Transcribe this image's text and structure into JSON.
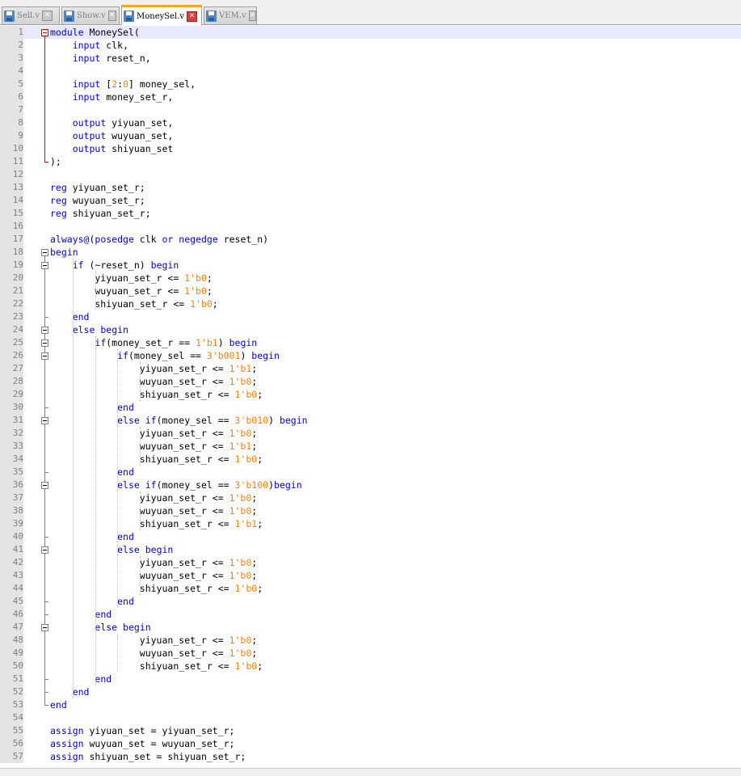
{
  "tabs": [
    {
      "label": "Sell.v",
      "active": false
    },
    {
      "label": "Show.v",
      "active": false
    },
    {
      "label": "MoneySel.v",
      "active": true
    },
    {
      "label": "VEM.v",
      "active": false
    }
  ],
  "colors": {
    "keyword": "#0000e0",
    "number": "#ff8000",
    "current_line": "#e8e8ff",
    "active_tab_accent": "#f5a623"
  },
  "current_line": 1,
  "code_lines": [
    [
      {
        "t": "module",
        "k": "kw"
      },
      {
        "t": " MoneySel("
      }
    ],
    [
      {
        "t": "    "
      },
      {
        "t": "input",
        "k": "kw"
      },
      {
        "t": " clk,"
      }
    ],
    [
      {
        "t": "    "
      },
      {
        "t": "input",
        "k": "kw"
      },
      {
        "t": " reset_n,"
      }
    ],
    [],
    [
      {
        "t": "    "
      },
      {
        "t": "input",
        "k": "kw"
      },
      {
        "t": " ["
      },
      {
        "t": "2",
        "k": "num"
      },
      {
        "t": ":"
      },
      {
        "t": "0",
        "k": "num"
      },
      {
        "t": "] money_sel,"
      }
    ],
    [
      {
        "t": "    "
      },
      {
        "t": "input",
        "k": "kw"
      },
      {
        "t": " money_set_r,"
      }
    ],
    [],
    [
      {
        "t": "    "
      },
      {
        "t": "output",
        "k": "kw"
      },
      {
        "t": " yiyuan_set,"
      }
    ],
    [
      {
        "t": "    "
      },
      {
        "t": "output",
        "k": "kw"
      },
      {
        "t": " wuyuan_set,"
      }
    ],
    [
      {
        "t": "    "
      },
      {
        "t": "output",
        "k": "kw"
      },
      {
        "t": " shiyuan_set"
      }
    ],
    [
      {
        "t": ");"
      }
    ],
    [],
    [
      {
        "t": "reg",
        "k": "kw"
      },
      {
        "t": " yiyuan_set_r;"
      }
    ],
    [
      {
        "t": "reg",
        "k": "kw"
      },
      {
        "t": " wuyuan_set_r;"
      }
    ],
    [
      {
        "t": "reg",
        "k": "kw"
      },
      {
        "t": " shiyuan_set_r;"
      }
    ],
    [],
    [
      {
        "t": "always@",
        "k": "kw"
      },
      {
        "t": "("
      },
      {
        "t": "posedge",
        "k": "kw"
      },
      {
        "t": " clk "
      },
      {
        "t": "or",
        "k": "kw"
      },
      {
        "t": " "
      },
      {
        "t": "negedge",
        "k": "kw"
      },
      {
        "t": " reset_n)"
      }
    ],
    [
      {
        "t": "begin",
        "k": "kw"
      }
    ],
    [
      {
        "t": "    "
      },
      {
        "t": "if",
        "k": "kw"
      },
      {
        "t": " (~reset_n) "
      },
      {
        "t": "begin",
        "k": "kw"
      }
    ],
    [
      {
        "t": "        yiyuan_set_r <= "
      },
      {
        "t": "1'b0",
        "k": "num"
      },
      {
        "t": ";"
      }
    ],
    [
      {
        "t": "        wuyuan_set_r <= "
      },
      {
        "t": "1'b0",
        "k": "num"
      },
      {
        "t": ";"
      }
    ],
    [
      {
        "t": "        shiyuan_set_r <= "
      },
      {
        "t": "1'b0",
        "k": "num"
      },
      {
        "t": ";"
      }
    ],
    [
      {
        "t": "    "
      },
      {
        "t": "end",
        "k": "kw"
      }
    ],
    [
      {
        "t": "    "
      },
      {
        "t": "else",
        "k": "kw"
      },
      {
        "t": " "
      },
      {
        "t": "begin",
        "k": "kw"
      }
    ],
    [
      {
        "t": "        "
      },
      {
        "t": "if",
        "k": "kw"
      },
      {
        "t": "(money_set_r == "
      },
      {
        "t": "1'b1",
        "k": "num"
      },
      {
        "t": ") "
      },
      {
        "t": "begin",
        "k": "kw"
      }
    ],
    [
      {
        "t": "            "
      },
      {
        "t": "if",
        "k": "kw"
      },
      {
        "t": "(money_sel == "
      },
      {
        "t": "3'b001",
        "k": "num"
      },
      {
        "t": ") "
      },
      {
        "t": "begin",
        "k": "kw"
      }
    ],
    [
      {
        "t": "                yiyuan_set_r <= "
      },
      {
        "t": "1'b1",
        "k": "num"
      },
      {
        "t": ";"
      }
    ],
    [
      {
        "t": "                wuyuan_set_r <= "
      },
      {
        "t": "1'b0",
        "k": "num"
      },
      {
        "t": ";"
      }
    ],
    [
      {
        "t": "                shiyuan_set_r <= "
      },
      {
        "t": "1'b0",
        "k": "num"
      },
      {
        "t": ";"
      }
    ],
    [
      {
        "t": "            "
      },
      {
        "t": "end",
        "k": "kw"
      }
    ],
    [
      {
        "t": "            "
      },
      {
        "t": "else",
        "k": "kw"
      },
      {
        "t": " "
      },
      {
        "t": "if",
        "k": "kw"
      },
      {
        "t": "(money_sel == "
      },
      {
        "t": "3'b010",
        "k": "num"
      },
      {
        "t": ") "
      },
      {
        "t": "begin",
        "k": "kw"
      }
    ],
    [
      {
        "t": "                yiyuan_set_r <= "
      },
      {
        "t": "1'b0",
        "k": "num"
      },
      {
        "t": ";"
      }
    ],
    [
      {
        "t": "                wuyuan_set_r <= "
      },
      {
        "t": "1'b1",
        "k": "num"
      },
      {
        "t": ";"
      }
    ],
    [
      {
        "t": "                shiyuan_set_r <= "
      },
      {
        "t": "1'b0",
        "k": "num"
      },
      {
        "t": ";"
      }
    ],
    [
      {
        "t": "            "
      },
      {
        "t": "end",
        "k": "kw"
      }
    ],
    [
      {
        "t": "            "
      },
      {
        "t": "else",
        "k": "kw"
      },
      {
        "t": " "
      },
      {
        "t": "if",
        "k": "kw"
      },
      {
        "t": "(money_sel == "
      },
      {
        "t": "3'b100",
        "k": "num"
      },
      {
        "t": ")"
      },
      {
        "t": "begin",
        "k": "kw"
      }
    ],
    [
      {
        "t": "                yiyuan_set_r <= "
      },
      {
        "t": "1'b0",
        "k": "num"
      },
      {
        "t": ";"
      }
    ],
    [
      {
        "t": "                wuyuan_set_r <= "
      },
      {
        "t": "1'b0",
        "k": "num"
      },
      {
        "t": ";"
      }
    ],
    [
      {
        "t": "                shiyuan_set_r <= "
      },
      {
        "t": "1'b1",
        "k": "num"
      },
      {
        "t": ";"
      }
    ],
    [
      {
        "t": "            "
      },
      {
        "t": "end",
        "k": "kw"
      }
    ],
    [
      {
        "t": "            "
      },
      {
        "t": "else",
        "k": "kw"
      },
      {
        "t": " "
      },
      {
        "t": "begin",
        "k": "kw"
      }
    ],
    [
      {
        "t": "                yiyuan_set_r <= "
      },
      {
        "t": "1'b0",
        "k": "num"
      },
      {
        "t": ";"
      }
    ],
    [
      {
        "t": "                wuyuan_set_r <= "
      },
      {
        "t": "1'b0",
        "k": "num"
      },
      {
        "t": ";"
      }
    ],
    [
      {
        "t": "                shiyuan_set_r <= "
      },
      {
        "t": "1'b0",
        "k": "num"
      },
      {
        "t": ";"
      }
    ],
    [
      {
        "t": "            "
      },
      {
        "t": "end",
        "k": "kw"
      }
    ],
    [
      {
        "t": "        "
      },
      {
        "t": "end",
        "k": "kw"
      }
    ],
    [
      {
        "t": "        "
      },
      {
        "t": "else",
        "k": "kw"
      },
      {
        "t": " "
      },
      {
        "t": "begin",
        "k": "kw"
      }
    ],
    [
      {
        "t": "                yiyuan_set_r <= "
      },
      {
        "t": "1'b0",
        "k": "num"
      },
      {
        "t": ";"
      }
    ],
    [
      {
        "t": "                wuyuan_set_r <= "
      },
      {
        "t": "1'b0",
        "k": "num"
      },
      {
        "t": ";"
      }
    ],
    [
      {
        "t": "                shiyuan_set_r <= "
      },
      {
        "t": "1'b0",
        "k": "num"
      },
      {
        "t": ";"
      }
    ],
    [
      {
        "t": "        "
      },
      {
        "t": "end",
        "k": "kw"
      }
    ],
    [
      {
        "t": "    "
      },
      {
        "t": "end",
        "k": "kw"
      }
    ],
    [
      {
        "t": "end",
        "k": "kw"
      }
    ],
    [],
    [
      {
        "t": "assign",
        "k": "kw"
      },
      {
        "t": " yiyuan_set = yiyuan_set_r;"
      }
    ],
    [
      {
        "t": "assign",
        "k": "kw"
      },
      {
        "t": " wuyuan_set = wuyuan_set_r;"
      }
    ],
    [
      {
        "t": "assign",
        "k": "kw"
      },
      {
        "t": " shiyuan_set = shiyuan_set_r;"
      }
    ]
  ],
  "folds": [
    {
      "start": 1,
      "end": 11,
      "highlight": true
    },
    {
      "start": 18,
      "end": 53
    },
    {
      "start": 19,
      "end": 23
    },
    {
      "start": 24,
      "end": 52
    },
    {
      "start": 25,
      "end": 46
    },
    {
      "start": 26,
      "end": 30
    },
    {
      "start": 31,
      "end": 35
    },
    {
      "start": 36,
      "end": 40
    },
    {
      "start": 41,
      "end": 45
    },
    {
      "start": 47,
      "end": 51
    }
  ]
}
